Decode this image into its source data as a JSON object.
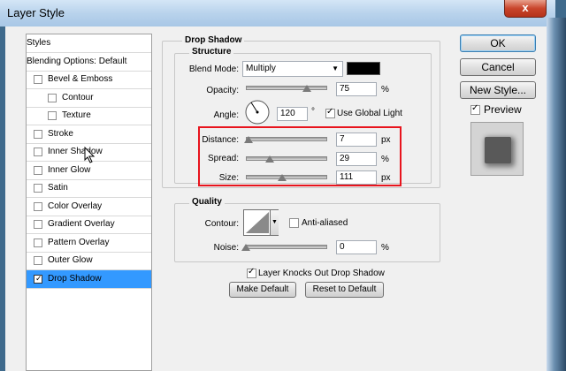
{
  "window": {
    "title": "Layer Style",
    "close_glyph": "x"
  },
  "styles_list": [
    {
      "label": "Styles",
      "kind": "header"
    },
    {
      "label": "Blending Options: Default",
      "kind": "header"
    },
    {
      "label": "Bevel & Emboss",
      "checked": false,
      "indent": 0
    },
    {
      "label": "Contour",
      "checked": false,
      "indent": 1
    },
    {
      "label": "Texture",
      "checked": false,
      "indent": 1
    },
    {
      "label": "Stroke",
      "checked": false,
      "indent": 0
    },
    {
      "label": "Inner Shadow",
      "checked": false,
      "indent": 0
    },
    {
      "label": "Inner Glow",
      "checked": false,
      "indent": 0
    },
    {
      "label": "Satin",
      "checked": false,
      "indent": 0
    },
    {
      "label": "Color Overlay",
      "checked": false,
      "indent": 0
    },
    {
      "label": "Gradient Overlay",
      "checked": false,
      "indent": 0
    },
    {
      "label": "Pattern Overlay",
      "checked": false,
      "indent": 0
    },
    {
      "label": "Outer Glow",
      "checked": false,
      "indent": 0
    },
    {
      "label": "Drop Shadow",
      "checked": true,
      "indent": 0,
      "selected": true
    }
  ],
  "drop_shadow": {
    "title": "Drop Shadow",
    "structure": {
      "title": "Structure",
      "blend_mode_label": "Blend Mode:",
      "blend_mode_value": "Multiply",
      "shadow_color": "#000000",
      "opacity_label": "Opacity:",
      "opacity_value": "75",
      "opacity_unit": "%",
      "opacity_fraction": 0.75,
      "angle_label": "Angle:",
      "angle_value": "120",
      "angle_unit": "°",
      "global_light_label": "Use Global Light",
      "global_light_checked": true,
      "distance_label": "Distance:",
      "distance_value": "7",
      "distance_unit": "px",
      "distance_fraction": 0.03,
      "spread_label": "Spread:",
      "spread_value": "29",
      "spread_unit": "%",
      "spread_fraction": 0.29,
      "size_label": "Size:",
      "size_value": "111",
      "size_unit": "px",
      "size_fraction": 0.45
    },
    "quality": {
      "title": "Quality",
      "contour_label": "Contour:",
      "anti_aliased_label": "Anti-aliased",
      "anti_aliased_checked": false,
      "noise_label": "Noise:",
      "noise_value": "0",
      "noise_unit": "%",
      "noise_fraction": 0.0
    },
    "knocks_out_label": "Layer Knocks Out Drop Shadow",
    "knocks_out_checked": true,
    "make_default_label": "Make Default",
    "reset_default_label": "Reset to Default"
  },
  "buttons": {
    "ok": "OK",
    "cancel": "Cancel",
    "new_style": "New Style...",
    "preview_label": "Preview",
    "preview_checked": true
  }
}
